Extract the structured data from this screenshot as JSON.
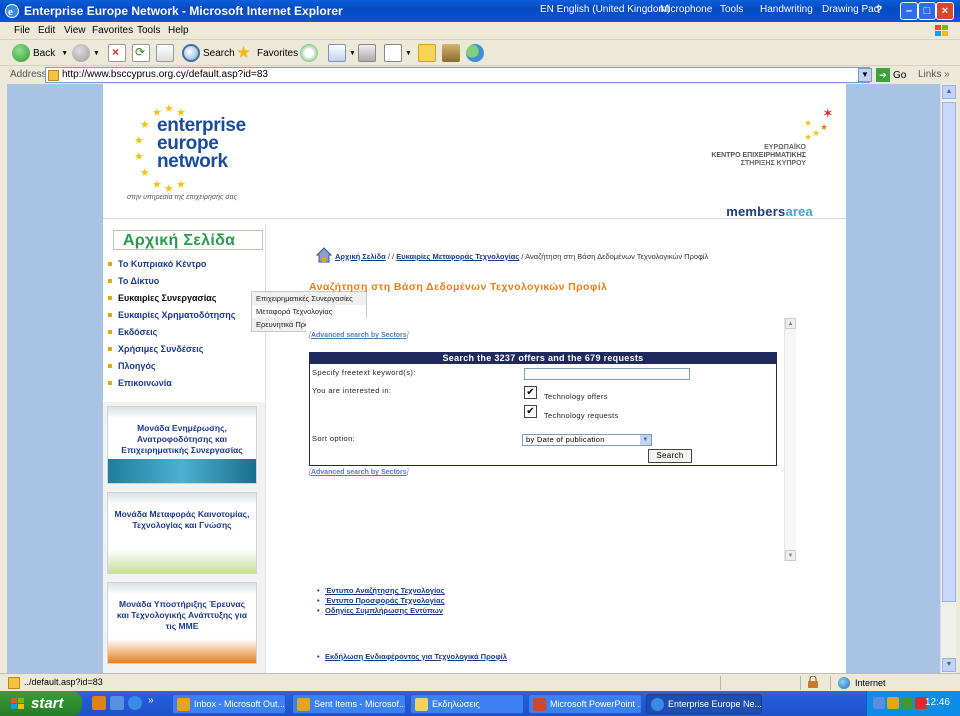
{
  "window": {
    "title": "Enterprise Europe Network - Microsoft Internet Explorer",
    "language": "EN English (United Kingdom)",
    "microphone": "Microphone",
    "tools": "Tools",
    "handwriting": "Handwriting",
    "drawing_pad": "Drawing Pad",
    "help_btn": "?"
  },
  "menu": {
    "items": [
      "File",
      "Edit",
      "View",
      "Favorites",
      "Tools",
      "Help"
    ]
  },
  "toolbar": {
    "back": "Back",
    "search": "Search",
    "favorites": "Favorites"
  },
  "address": {
    "label": "Address",
    "url": "http://www.bsccyprus.org.cy/default.asp?id=83",
    "go": "Go",
    "links": "Links"
  },
  "header": {
    "logo_line1": "enterprise",
    "logo_line2": "europe",
    "logo_line3": "network",
    "logo_sub": "στην υπηρεσία της επιχείρησής σας",
    "org_line1": "ΕΥΡΩΠΑΪΚΟ",
    "org_line2": "ΚΕΝΤΡΟ ΕΠΙΧΕΙΡΗΜΑΤΙΚΗΣ",
    "org_line3": "ΣΤΗΡΙΞΗΣ ΚΥΠΡΟΥ",
    "members_1": "members",
    "members_2": "area"
  },
  "nav": {
    "title": "Αρχική Σελίδα",
    "items": [
      "Το Κυπριακό Κέντρο",
      "Το Δίκτυο",
      "Ευκαιρίες Συνεργασίας",
      "Ευκαιρίες Χρηματοδότησης",
      "Εκδόσεις",
      "Χρήσιμες Συνδέσεις",
      "Πλοηγός",
      "Επικοινωνία"
    ],
    "submenu": [
      "Επιχειρηματικές Συνεργασίες",
      "Μεταφορά Τεχνολογίας",
      "Ερευνητικά Προγράμματα"
    ],
    "promos": [
      "Μονάδα Ενημέρωσης, Ανατροφοδότησης και Επιχειρηματικής Συνεργασίας",
      "Μονάδα Μεταφοράς Καινοτομίας, Τεχνολογίας και Γνώσης",
      "Μονάδα Υποστήριξης Έρευνας και Τεχνολογικής Ανάπτυξης για τις ΜΜΕ"
    ]
  },
  "breadcrumb": {
    "home": "Αρχική Σελίδα",
    "sep1": " / / ",
    "level2": "Ευκαιρίες Μεταφοράς Τεχνολογίας",
    "sep2": " / ",
    "current": "Αναζήτηση στη Βάση Δεδομένων Τεχνολογικών Προφίλ"
  },
  "main": {
    "title": "Αναζήτηση στη Βάση Δεδομένων Τεχνολογικών Προφίλ",
    "adv_link": "Advanced search by Sectors",
    "bracket_open": "[",
    "bracket_close": "]",
    "search_header": "Search the 3237 offers and the 679 requests",
    "keyword_label": "Specify freetext keyword(s):",
    "keyword_value": "",
    "interest_label": "You are interested in:",
    "opt_offers": "Technology offers",
    "opt_requests": "Technology requests",
    "check_mark": "✔",
    "sort_label": "Sort option:",
    "sort_value": "by Date of publication",
    "search_btn": "Search",
    "links": [
      "Έντυπο Αναζήτησης Τεχνολογίας",
      "Έντυπο Προσφοράς Τεχνολογίας",
      "Οδηγίες Συμπλήρωσης Εντύπων",
      "Εκδήλωση Ενδιαφέροντος για Τεχνολογικά Προφίλ"
    ]
  },
  "status": {
    "text": "../default.asp?id=83",
    "zone": "Internet"
  },
  "taskbar": {
    "start": "start",
    "buttons": [
      "Inbox - Microsoft Out...",
      "Sent Items - Microsof...",
      "Εκδηλώσεις",
      "Microsoft PowerPoint ...",
      "Enterprise Europe Ne..."
    ],
    "clock": "12:46",
    "chevron": "»"
  }
}
